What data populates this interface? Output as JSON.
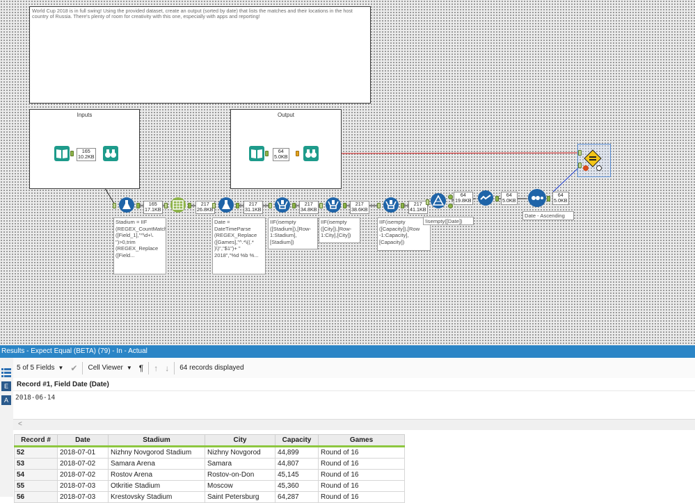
{
  "canvas": {
    "comment": "World Cup 2018 is in full swing!  Using the provided dataset, create an output (sorted by date) that lists the matches and their locations in the host country of Russia.  There's plenty of room for creativity with this one, especially with apps and reporting!",
    "containers": {
      "inputs": "Inputs",
      "output": "Output"
    },
    "stats": {
      "inputs_stat": [
        "165",
        "10.2KB"
      ],
      "output_stat": [
        "64",
        "5.0KB"
      ],
      "s1": [
        "165",
        "17.1KB"
      ],
      "s2": [
        "217",
        "26.8KB"
      ],
      "s3": [
        "217",
        "31.1KB"
      ],
      "s4": [
        "217",
        "34.8KB"
      ],
      "s5": [
        "217",
        "38.6KB"
      ],
      "s6": [
        "217",
        "41.1KB"
      ],
      "s7": [
        "64",
        "19.8KB"
      ],
      "s8": [
        "64",
        "5.0KB"
      ],
      "s9": [
        "64",
        "5.0KB"
      ]
    },
    "annotations": {
      "formula1": "Stadium = IIF (REGEX_CountMatches ([Field_1],\"^\\d+\\. \")>0,trim (REGEX_Replace ([Field...",
      "formula2": "Date = DateTimeParse (REGEX_Replace ([Games],\"^.*\\((.* )\\)\",\"$1\")+ \" 2018\",\"%d %b %...",
      "multirow1": "IIF(isempty ([Stadium]),[Row-1:Stadium], [Stadium])",
      "multirow2": "IIF(isempty ([City]),[Row-1:City],[City])",
      "multirow3": "IIF(isempty ([Capacity]),[Row -1:Capacity], [Capacity])",
      "filter": "!isempty([Date])",
      "sort": "Date - Ascending"
    }
  },
  "results": {
    "header": "Results - Expect Equal (BETA) (79) - In - Actual",
    "toolbar": {
      "fields": "5 of 5 Fields",
      "viewer": "Cell Viewer",
      "records": "64 records displayed"
    },
    "record_title": "Record #1, Field Date (Date)",
    "cell_value": "2018-06-14",
    "columns": [
      "Record #",
      "Date",
      "Stadium",
      "City",
      "Capacity",
      "Games"
    ],
    "rows": [
      [
        "52",
        "2018-07-01",
        "Nizhny Novgorod Stadium",
        "Nizhny Novgorod",
        "44,899",
        "Round of 16"
      ],
      [
        "53",
        "2018-07-02",
        "Samara Arena",
        "Samara",
        "44,807",
        "Round of 16"
      ],
      [
        "54",
        "2018-07-02",
        "Rostov Arena",
        "Rostov-on-Don",
        "45,145",
        "Round of 16"
      ],
      [
        "55",
        "2018-07-03",
        "Otkritie Stadium",
        "Moscow",
        "45,360",
        "Round of 16"
      ],
      [
        "56",
        "2018-07-03",
        "Krestovsky Stadium",
        "Saint Petersburg",
        "64,287",
        "Round of 16"
      ]
    ]
  },
  "colors": {
    "accent_blue": "#2b85c6",
    "tool_blue": "#1f64a8",
    "tool_teal": "#1e9b8b",
    "tool_green": "#8db348",
    "wire_red": "#d11a1a",
    "wire_blue": "#1c3cd0",
    "grid_header_bar": "#8dc63f"
  }
}
